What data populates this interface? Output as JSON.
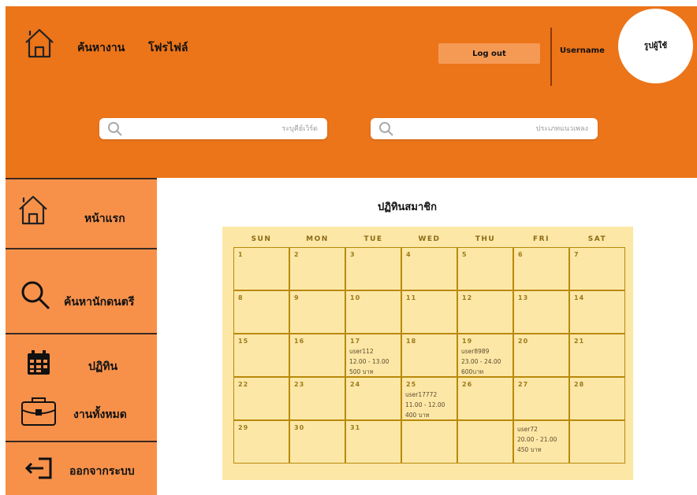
{
  "header": {
    "home_icon": "house-icon",
    "nav": [
      "ค้นหางาน",
      "โฟรไฟล์"
    ],
    "logout_label": "Log out",
    "username": "Username",
    "avatar_label": "รูปผู้ใช้",
    "search_left_placeholder": "ระบุคีย์เวิร์ด",
    "search_right_placeholder": "ประเภทแนวเพลง",
    "search_icon": "search-icon"
  },
  "sidebar": {
    "items": [
      {
        "label": "หน้าแรก",
        "icon": "house-icon"
      },
      {
        "label": "ค้นหานักดนตรี",
        "icon": "search-icon"
      },
      {
        "label": "ปฏิทิน",
        "icon": "calendar-icon"
      },
      {
        "label": "งานทั้งหมด",
        "icon": "briefcase-icon"
      },
      {
        "label": "ออกจากระบบ",
        "icon": "logout-icon"
      }
    ]
  },
  "calendar": {
    "title": "ปฏิทินสมาชิก",
    "weekdays": [
      "SUN",
      "MON",
      "TUE",
      "WED",
      "THU",
      "FRI",
      "SAT"
    ],
    "weeks": [
      [
        "1",
        "2",
        "3",
        "4",
        "5",
        "6",
        "7"
      ],
      [
        "8",
        "9",
        "10",
        "11",
        "12",
        "13",
        "14"
      ],
      [
        "15",
        "16",
        "17",
        "18",
        "19",
        "20",
        "21"
      ],
      [
        "22",
        "23",
        "24",
        "25",
        "26",
        "27",
        "28"
      ],
      [
        "29",
        "30",
        "31",
        "",
        "",
        "",
        ""
      ]
    ],
    "events": [
      {
        "week": 2,
        "day": 2,
        "user": "user112",
        "time": "12.00 - 13.00",
        "price": "500 บาท"
      },
      {
        "week": 2,
        "day": 4,
        "user": "user8989",
        "time": "23.00 - 24.00",
        "price": "600บาท"
      },
      {
        "week": 3,
        "day": 3,
        "user": "user17772",
        "time": "11.00 - 12.00",
        "price": "400 บาท"
      },
      {
        "week": 4,
        "day": 5,
        "user": "user72",
        "time": "20.00 - 21.00",
        "price": "450 บาท"
      }
    ]
  },
  "colors": {
    "header": "#ec7419",
    "sidebar": "#f7914a",
    "calendar_bg": "#fde7a7",
    "grid_line": "#b88a0b"
  }
}
